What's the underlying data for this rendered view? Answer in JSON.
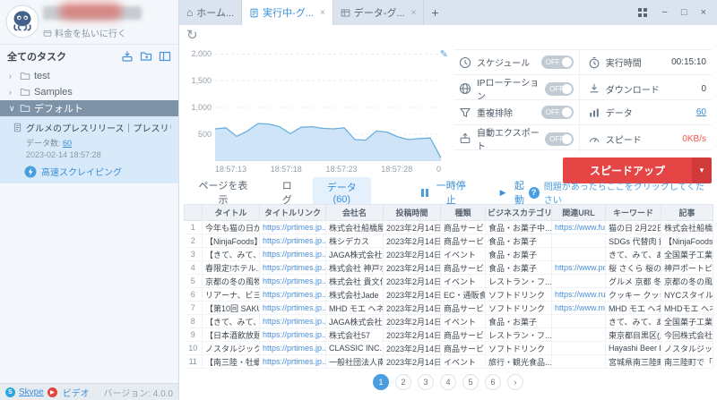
{
  "icons": {
    "home": "⌂",
    "minimize": "−",
    "maximize": "□",
    "close": "×",
    "tab_close": "×",
    "tab_add": "+",
    "refresh": "↻",
    "edit": "✎",
    "play": "▶",
    "dropdown": "▾",
    "next": "›",
    "chevron_collapsed": "›",
    "chevron_expanded": "∨",
    "help": "?",
    "skype_s": "S",
    "video_play": "▶"
  },
  "sidebar": {
    "pay_link": "料金を払いに行く",
    "tasks_header": "全てのタスク",
    "folders": [
      {
        "label": "test"
      },
      {
        "label": "Samples"
      },
      {
        "label": "デフォルト"
      }
    ],
    "task": {
      "title": "グルメのプレスリリース｜プレスリリース...",
      "count_label": "データ数:",
      "count_value": "60",
      "timestamp": "2023-02-14 18:57:28",
      "mode": "高速スクレイピング"
    },
    "footer": {
      "skype": "Skype",
      "video": "ビデオ",
      "version": "バージョン: 4.0.0"
    }
  },
  "tabs": [
    {
      "label": "ホーム..."
    },
    {
      "label": "実行中-グ..."
    },
    {
      "label": "データ-グ..."
    }
  ],
  "chart_data": {
    "type": "area",
    "title": "",
    "ylabel": "",
    "xlabel": "",
    "ylim": [
      0,
      2000
    ],
    "yticks": [
      "2,000",
      "1,500",
      "1,000",
      "500"
    ],
    "xticks": [
      "18:57:13",
      "18:57:18",
      "18:57:23",
      "18:57:28",
      "0"
    ],
    "series": [
      {
        "name": "スピード",
        "values": [
          600,
          620,
          460,
          560,
          700,
          690,
          640,
          510,
          630,
          640,
          610,
          600,
          620,
          400,
          390,
          560,
          540,
          450,
          400,
          420,
          430,
          60
        ]
      }
    ]
  },
  "control_panel": {
    "rows": [
      {
        "label": "スケジュール",
        "toggle": "OFF",
        "stat_label": "実行時間",
        "stat_value": "00:15:10"
      },
      {
        "label": "IPローテーション",
        "toggle": "OFF",
        "stat_label": "ダウンロード",
        "stat_value": "0"
      },
      {
        "label": "重複排除",
        "toggle": "OFF",
        "stat_label": "データ",
        "stat_value": "60"
      },
      {
        "label": "自動エクスポート",
        "toggle": "OFF",
        "stat_label": "スピード",
        "stat_value": "0KB/s"
      }
    ],
    "speedup": "スピードアップ"
  },
  "toolbar": {
    "view_tabs": [
      {
        "label": "ページを表示"
      },
      {
        "label": "ログ"
      },
      {
        "label": "データ(60)"
      }
    ],
    "pause": "一時停止",
    "start": "起動",
    "help": "問題があったらここをクリックしてください"
  },
  "table": {
    "columns": [
      "",
      "タイトル",
      "タイトルリンク",
      "会社名",
      "投稿時間",
      "種類",
      "ビジネスカテゴリ",
      "関連URL",
      "キーワード",
      "記事"
    ],
    "rows": [
      [
        "1",
        "今年も猫の日が...",
        "https://prtimes.jp...",
        "株式会社船橋屋",
        "2023年2月14日",
        "商品サービス",
        "食品・お菓子中...",
        "https://www.funa...",
        "猫の日 2月22日...",
        "株式会社船橋屋..."
      ],
      [
        "2",
        "【NinjaFoods】...",
        "https://prtimes.jp...",
        "株シデカス",
        "2023年2月14日",
        "商品サービス",
        "食品・お菓子",
        "",
        "SDGs 代替肉 飲...",
        "【NinjaFoods公..."
      ],
      [
        "3",
        "【きて、みて、...",
        "https://prtimes.jp...",
        "JAGA株式会社",
        "2023年2月14日",
        "イベント",
        "食品・お菓子",
        "",
        "きて、みて、あそ...",
        "全国菓子工業協..."
      ],
      [
        "4",
        "春限定!ホテル...",
        "https://prtimes.jp...",
        "株式会社 神戸ポ...",
        "2023年2月14日",
        "商品サービス",
        "食品・お菓子",
        "https://www.port...",
        "桜 さくら 桜の花...",
        "神戸ポートピアホ..."
      ],
      [
        "5",
        "京都の冬の風物...",
        "https://prtimes.jp...",
        "株式会社 貴文化",
        "2023年2月14日",
        "イベント",
        "レストラン・フ...",
        "",
        "グルメ 京都 冬...",
        "京都の冬の風物..."
      ],
      [
        "6",
        "リアーナ、ビヨ...",
        "https://prtimes.jp...",
        "株式会社Jade",
        "2023年2月14日",
        "EC・通販食品・",
        "ソフトドリンク",
        "https://www.rum...",
        "クッキー クッキ...",
        "NYCスタイルの..."
      ],
      [
        "7",
        "【第10回 SAKU...",
        "https://prtimes.jp...",
        "MHD モエ ヘネ...",
        "2023年2月14日",
        "商品サービス",
        "ソフトドリンク",
        "https://www.mhd...",
        "MHD モエ ヘネ...",
        "MHDモエ ヘネ..."
      ],
      [
        "8",
        "【きて、みて、...",
        "https://prtimes.jp...",
        "JAGA株式会社",
        "2023年2月14日",
        "イベント",
        "食品・お菓子",
        "",
        "きて、みて、あそ...",
        "全国菓子工業協..."
      ],
      [
        "9",
        "【日本酒飲放題...",
        "https://prtimes.jp...",
        "株式会社57",
        "2023年2月14日",
        "商品サービス",
        "レストラン・フ...",
        "",
        "東京都目黒区(店...",
        "今回株式会社57..."
      ],
      [
        "10",
        "ノスタルジック...",
        "https://prtimes.jp...",
        "CLASSIC INC.",
        "2023年2月14日",
        "商品サービス",
        "ソフトドリンク",
        "",
        "Hayashi Beer Da...",
        "ノスタルジック..."
      ],
      [
        "11",
        "【南三陸・牡蠣...",
        "https://prtimes.jp...",
        "一般社団法人南...",
        "2023年2月14日",
        "イベント",
        "旅行・観光食品...",
        "",
        "宮城県南三陸町...",
        "南三陸町で「牡..."
      ]
    ]
  },
  "pagination": {
    "pages": [
      "1",
      "2",
      "3",
      "4",
      "5",
      "6"
    ],
    "active": "1"
  }
}
